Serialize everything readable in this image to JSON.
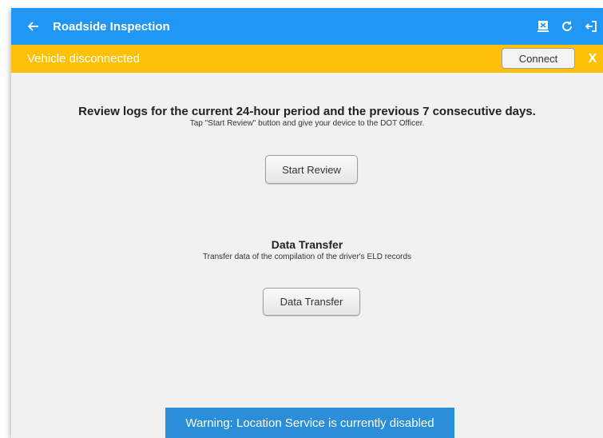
{
  "appbar": {
    "title": "Roadside Inspection",
    "back_icon": "arrow-left-icon",
    "actions": [
      "eld-device-icon",
      "refresh-icon",
      "logout-icon"
    ]
  },
  "banner": {
    "status_text": "Vehicle disconnected",
    "connect_label": "Connect",
    "dismiss_label": "X",
    "color": "#ffc107"
  },
  "review": {
    "heading": "Review logs for the current 24-hour period and the previous 7 consecutive days.",
    "subtext": "Tap \"Start Review\" button and give your device to the DOT Officer.",
    "button_label": "Start Review"
  },
  "transfer": {
    "heading": "Data Transfer",
    "subtext": "Transfer data of the compilation of the driver's ELD records",
    "button_label": "Data Transfer"
  },
  "toast": {
    "message": "Warning: Location Service is currently disabled"
  },
  "colors": {
    "primary": "#2196f3",
    "banner": "#ffc107",
    "toast": "#2a8fd8"
  }
}
